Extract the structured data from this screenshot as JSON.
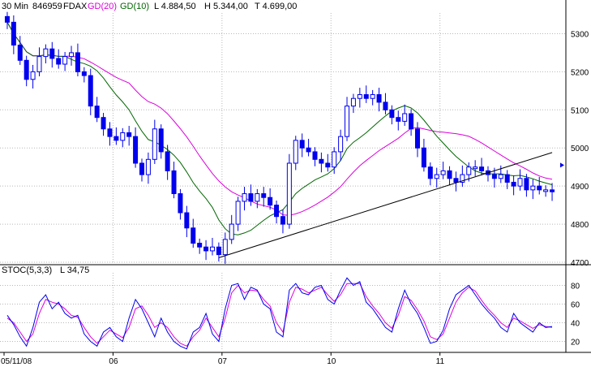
{
  "header": {
    "timeframe": "30 Min",
    "symbol_id": "846959",
    "symbol": "FDAX",
    "ma20_label": "GD(20)",
    "ma10_label": "GD(10)",
    "low_label": "L  4.884,50",
    "high_label": "H  5.344,00",
    "last_label": "T  4.699,00"
  },
  "stoch_header": {
    "label": "STOC(5,3,3)",
    "value_label": "L  34,75"
  },
  "colors": {
    "candle": "#0000ee",
    "ma20": "#dd00dd",
    "ma10": "#006600",
    "stoch_k": "#0000ee",
    "stoch_d": "#dd00dd",
    "grid": "#b8b8b8",
    "trendline": "#000000",
    "marker": "#0000ee"
  },
  "chart_data": [
    {
      "type": "candlestick",
      "ylim": [
        4700,
        5350
      ],
      "yticks": [
        4700,
        4800,
        4900,
        5000,
        5100,
        5200,
        5300
      ],
      "x_labels": [
        {
          "label": "05/11/08",
          "bar": 0
        },
        {
          "label": "06",
          "bar": 17
        },
        {
          "label": "07",
          "bar": 34
        },
        {
          "label": "10",
          "bar": 51
        },
        {
          "label": "11",
          "bar": 68
        }
      ],
      "bars_total": 86,
      "close": [
        5330,
        5270,
        5230,
        5180,
        5200,
        5240,
        5260,
        5235,
        5220,
        5240,
        5250,
        5200,
        5190,
        5110,
        5080,
        5050,
        5030,
        5020,
        5040,
        5030,
        4960,
        4930,
        4970,
        5050,
        4990,
        4940,
        4880,
        4830,
        4790,
        4750,
        4740,
        4730,
        4740,
        4720,
        4760,
        4800,
        4860,
        4880,
        4860,
        4880,
        4870,
        4850,
        4820,
        4800,
        4960,
        5020,
        5000,
        4990,
        4970,
        4960,
        4950,
        4990,
        5030,
        5110,
        5130,
        5140,
        5130,
        5140,
        5120,
        5100,
        5080,
        5070,
        5090,
        5050,
        5000,
        4950,
        4920,
        4930,
        4940,
        4920,
        4910,
        4930,
        4950,
        4950,
        4940,
        4930,
        4920,
        4930,
        4910,
        4900,
        4920,
        4890,
        4900,
        4890,
        4890,
        4885
      ],
      "trendline": {
        "from": {
          "bar": 33,
          "value": 4712
        },
        "to": {
          "bar": 85,
          "value": 4988
        }
      },
      "marker_value": 4955
    },
    {
      "type": "line",
      "title": "STOC(5,3,3)",
      "ylim": [
        10,
        90
      ],
      "yticks": [
        20,
        40,
        60,
        80
      ],
      "series": [
        {
          "name": "%K",
          "values": [
            48,
            38,
            25,
            15,
            35,
            62,
            70,
            55,
            62,
            50,
            45,
            48,
            28,
            20,
            15,
            30,
            35,
            25,
            20,
            45,
            65,
            55,
            40,
            25,
            45,
            30,
            20,
            15,
            12,
            30,
            35,
            50,
            28,
            20,
            55,
            80,
            82,
            65,
            78,
            75,
            60,
            55,
            30,
            25,
            75,
            82,
            72,
            70,
            78,
            80,
            65,
            60,
            75,
            88,
            80,
            84,
            62,
            55,
            45,
            35,
            30,
            55,
            75,
            60,
            50,
            35,
            18,
            20,
            32,
            55,
            70,
            75,
            80,
            70,
            60,
            52,
            45,
            35,
            30,
            50,
            40,
            35,
            30,
            40,
            35,
            36
          ]
        },
        {
          "name": "%D",
          "values": [
            45,
            40,
            30,
            20,
            28,
            50,
            65,
            62,
            60,
            55,
            48,
            46,
            35,
            25,
            18,
            25,
            32,
            28,
            24,
            35,
            55,
            58,
            48,
            35,
            40,
            35,
            25,
            18,
            15,
            25,
            32,
            45,
            35,
            25,
            45,
            72,
            80,
            72,
            75,
            74,
            65,
            58,
            40,
            30,
            62,
            78,
            76,
            72,
            75,
            78,
            70,
            63,
            70,
            82,
            82,
            82,
            68,
            58,
            50,
            40,
            34,
            48,
            68,
            64,
            54,
            42,
            25,
            22,
            28,
            45,
            62,
            72,
            78,
            74,
            64,
            55,
            48,
            40,
            35,
            45,
            42,
            38,
            34,
            38,
            36,
            35
          ]
        }
      ]
    }
  ]
}
